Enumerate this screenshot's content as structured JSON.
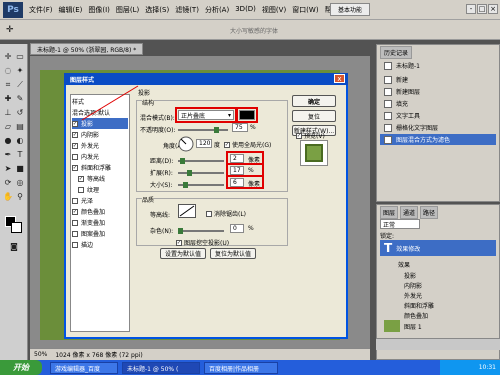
{
  "app": {
    "logo": "Ps",
    "menu": [
      "文件(F)",
      "编辑(E)",
      "图像(I)",
      "图层(L)",
      "选择(S)",
      "滤镜(T)",
      "分析(A)",
      "3D(D)",
      "视图(V)",
      "窗口(W)",
      "帮助(H)"
    ],
    "zoom": "50%",
    "workspace_btn": "基本功能",
    "win_controls": [
      "-",
      "□",
      "×"
    ],
    "options_hint": "大小写敏感的字体"
  },
  "document": {
    "tab": "未标题-1 @ 50% (浙翠园, RGB/8) *",
    "status_zoom": "50%",
    "status_info": "1024 像素 x 768 像素 (72 ppi)"
  },
  "history": {
    "tab": "历史记录",
    "items": [
      {
        "label": "未标题-1"
      },
      {
        "label": "新建"
      },
      {
        "label": "新建图层"
      },
      {
        "label": "填充"
      },
      {
        "label": "文字工具"
      },
      {
        "label": "栅格化文字图层"
      },
      {
        "label": "图层混合方式为滤色"
      }
    ]
  },
  "layers": {
    "tabs": [
      "图层",
      "通道",
      "路径"
    ],
    "blend": "正常",
    "lock": "锁定:",
    "text_layer": "效果修改",
    "effects_label": "效果",
    "effects": [
      "投影",
      "内阴影",
      "外发光",
      "斜面和浮雕",
      "颜色叠加"
    ],
    "bg_layer": "图层 1"
  },
  "dialog": {
    "title": "图层样式",
    "close": "x",
    "styles_header": "样式",
    "blend_options": "混合选项:默认",
    "style_items": [
      {
        "label": "投影",
        "checked": true,
        "selected": true
      },
      {
        "label": "内阴影",
        "checked": true
      },
      {
        "label": "外发光",
        "checked": true
      },
      {
        "label": "内发光",
        "checked": false
      },
      {
        "label": "斜面和浮雕",
        "checked": true
      },
      {
        "label": "等高线",
        "checked": true
      },
      {
        "label": "纹理",
        "checked": false
      },
      {
        "label": "光泽",
        "checked": false
      },
      {
        "label": "颜色叠加",
        "checked": true
      },
      {
        "label": "渐变叠加",
        "checked": false
      },
      {
        "label": "图案叠加",
        "checked": false
      },
      {
        "label": "描边",
        "checked": false
      }
    ],
    "section_title": "投影",
    "structure": "结构",
    "blend_mode_label": "混合模式(B):",
    "blend_mode": "正片叠底",
    "opacity_label": "不透明度(O):",
    "opacity_value": "75",
    "opacity_unit": "%",
    "angle_label": "角度(A):",
    "angle_value": "120",
    "angle_unit": "度",
    "global_light": "使用全局光(G)",
    "distance_label": "距离(D):",
    "distance_value": "2",
    "distance_unit": "像素",
    "spread_label": "扩展(R):",
    "spread_value": "17",
    "spread_unit": "%",
    "size_label": "大小(S):",
    "size_value": "6",
    "size_unit": "像素",
    "quality": "品质",
    "contour_label": "等高线:",
    "antialias": "消除锯齿(L)",
    "noise_label": "杂色(N):",
    "noise_value": "0",
    "noise_unit": "%",
    "knockout": "图层挖空投影(U)",
    "default_btn": "设置为默认值",
    "reset_btn": "复位为默认值",
    "ok": "确定",
    "cancel": "复位",
    "new_style": "新建样式(W)...",
    "preview": "预览(V)",
    "color_swatch": "#000000"
  },
  "taskbar": {
    "start": "开始",
    "tasks": [
      "游戏编辑器_百度",
      "未标题-1 @ 50% (",
      "百度相册|作品相册"
    ],
    "tray": "10:31"
  }
}
